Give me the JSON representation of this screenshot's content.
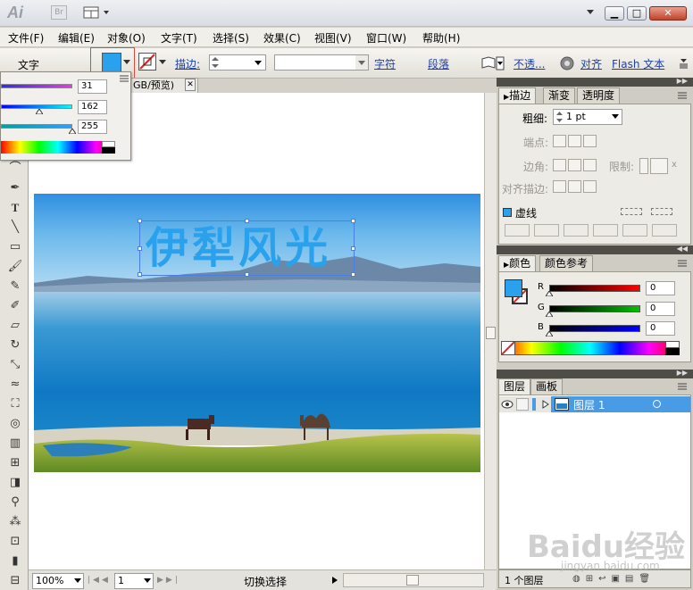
{
  "app": {
    "logo": "Ai",
    "bridge": "Br"
  },
  "menu": [
    "文件(F)",
    "编辑(E)",
    "对象(O)",
    "文字(T)",
    "选择(S)",
    "效果(C)",
    "视图(V)",
    "窗口(W)",
    "帮助(H)"
  ],
  "control_bar": {
    "tool_label": "文字",
    "fill_color": "#2aa1ec",
    "stroke_label": "描边:",
    "char_link": "字符",
    "para_link": "段落",
    "opacity_link": "不透...",
    "align_link": "对齐",
    "flash_link": "Flash 文本"
  },
  "flyout": {
    "values": [
      "31",
      "162",
      "255"
    ]
  },
  "document": {
    "tab_label": "GB/预览)",
    "image_text": "伊犁风光",
    "text_color": "#2aa1ec"
  },
  "status": {
    "zoom": "100%",
    "page": "1",
    "mode": "切换选择"
  },
  "stroke_panel": {
    "tabs": [
      "描边",
      "渐变",
      "透明度"
    ],
    "weight_label": "粗细:",
    "weight_value": "1 pt",
    "cap_label": "端点:",
    "corner_label": "边角:",
    "limit_label": "限制:",
    "limit_unit": "x",
    "align_label": "对齐描边:",
    "dashed_label": "虚线"
  },
  "color_panel": {
    "tabs": [
      "颜色",
      "颜色参考"
    ],
    "r_label": "R",
    "g_label": "G",
    "b_label": "B",
    "r_value": "0",
    "g_value": "0",
    "b_value": "0",
    "fill_color": "#2aa1ec"
  },
  "layers_panel": {
    "tabs": [
      "图层",
      "画板"
    ],
    "layer_name": "图层 1",
    "footer": "1 个图层",
    "selection_color": "#4a9be6"
  },
  "watermark": {
    "brand": "Baidu经验",
    "url": "jingyan.baidu.com"
  }
}
